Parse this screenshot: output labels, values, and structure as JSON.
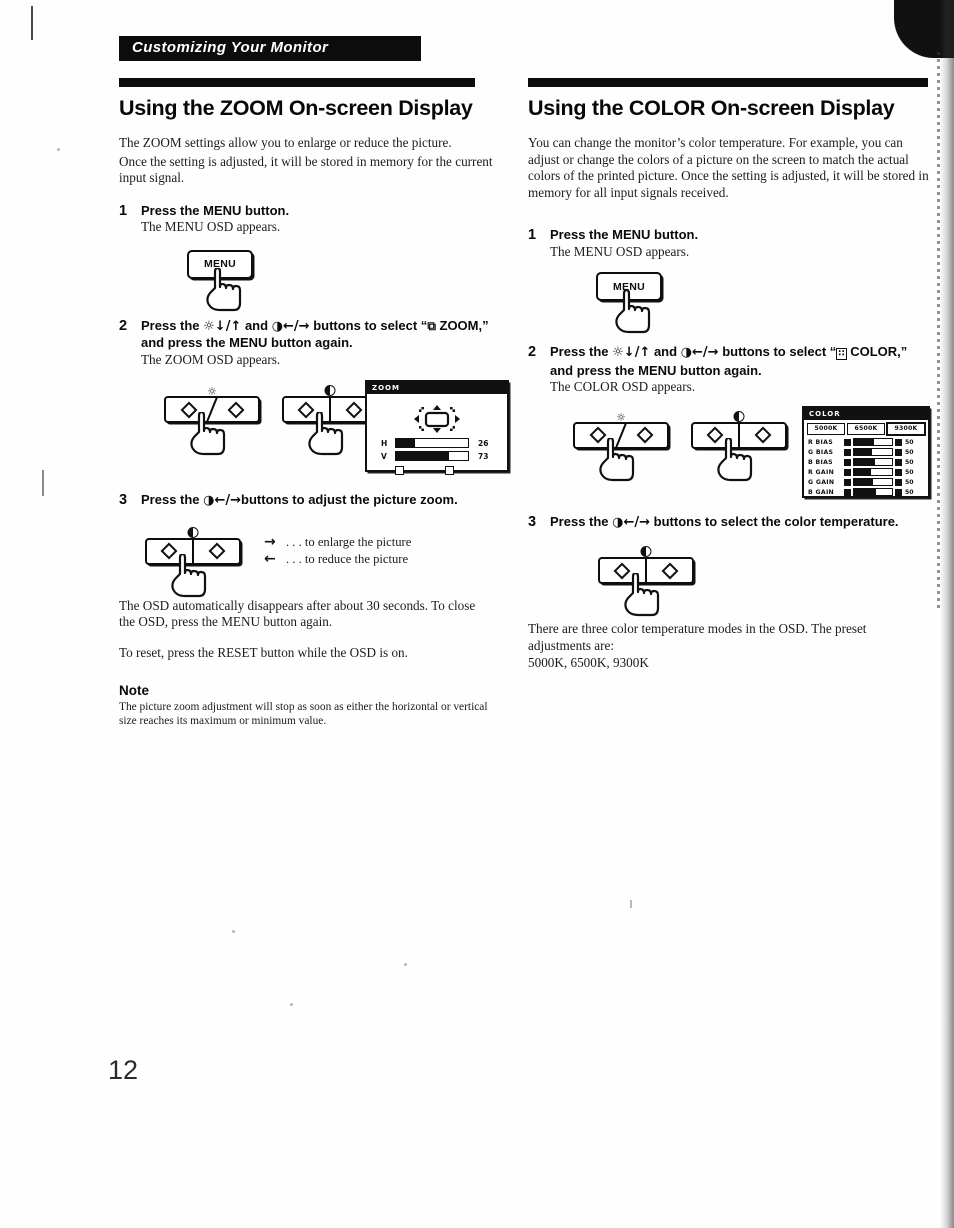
{
  "header": {
    "running_title": "Customizing Your Monitor"
  },
  "page": {
    "number": "12"
  },
  "left": {
    "title": "Using the ZOOM On-screen Display",
    "intro_1": "The ZOOM settings allow you to enlarge or reduce the picture.",
    "intro_2": "Once the setting is adjusted, it will be stored in memory for the current input signal.",
    "step1": {
      "num": "1",
      "head": "Press the MENU button.",
      "sub": "The MENU OSD appears.",
      "key_label": "MENU"
    },
    "step2": {
      "num": "2",
      "head_a": "Press the ",
      "head_glyph1": "☼↓/↑",
      "head_b": " and ",
      "head_glyph2": "◑←/→",
      "head_c": " buttons to select “",
      "head_icon": "⧉",
      "head_d": " ZOOM,” and press the MENU button again.",
      "sub": "The ZOOM OSD appears."
    },
    "step3": {
      "num": "3",
      "head_a": "Press the ",
      "head_glyph": "◑←/→",
      "head_b": "buttons to adjust the picture zoom."
    },
    "legend": [
      {
        "arrow": "→",
        "text": ". . . to enlarge the picture"
      },
      {
        "arrow": "←",
        "text": ". . . to reduce the picture"
      }
    ],
    "closing_1": "The OSD automatically disappears after about 30 seconds. To close the OSD, press the MENU button again.",
    "closing_2": "To reset,  press the RESET button while the OSD is on.",
    "note_heading": "Note",
    "note_body": "The picture zoom adjustment will stop as soon as either the horizontal or vertical size reaches its maximum or minimum value.",
    "osd": {
      "title": "ZOOM",
      "rows": [
        {
          "label": "H",
          "value": "26",
          "fill_pct": 26
        },
        {
          "label": "V",
          "value": "73",
          "fill_pct": 73
        }
      ]
    }
  },
  "right": {
    "title": "Using the COLOR On-screen Display",
    "intro_1": "You can change the monitor’s color temperature. For example, you can adjust or change the colors of a picture on the screen to match the actual colors of the printed picture. Once the setting is adjusted, it will be stored in memory for all input signals received.",
    "step1": {
      "num": "1",
      "head": "Press the MENU button.",
      "sub": "The MENU OSD appears.",
      "key_label": "MENU"
    },
    "step2": {
      "num": "2",
      "head_a": "Press the ",
      "head_glyph1": "☼↓/↑",
      "head_b": " and ",
      "head_glyph2": "◑←/→",
      "head_c": " buttons to select “",
      "head_icon": "∷",
      "head_d": " COLOR,” and press the MENU button again.",
      "sub": "The COLOR OSD appears."
    },
    "step3": {
      "num": "3",
      "head_a": "Press the ",
      "head_glyph": "◑←/→",
      "head_b": " buttons to select the color temperature."
    },
    "closing_1": "There are three color temperature modes in the OSD. The preset adjustments are:",
    "closing_2": "5000K, 6500K, 9300K",
    "osd": {
      "title": "COLOR",
      "temps": [
        "5000K",
        "6500K",
        "9300K"
      ],
      "rows": [
        {
          "label": "R  BIAS",
          "value": "50",
          "fill_pct": 52
        },
        {
          "label": "G  BIAS",
          "value": "50",
          "fill_pct": 48
        },
        {
          "label": "B  BIAS",
          "value": "50",
          "fill_pct": 55
        },
        {
          "label": "R  GAIN",
          "value": "50",
          "fill_pct": 45
        },
        {
          "label": "G  GAIN",
          "value": "50",
          "fill_pct": 50
        },
        {
          "label": "B  GAIN",
          "value": "50",
          "fill_pct": 58
        }
      ]
    }
  }
}
